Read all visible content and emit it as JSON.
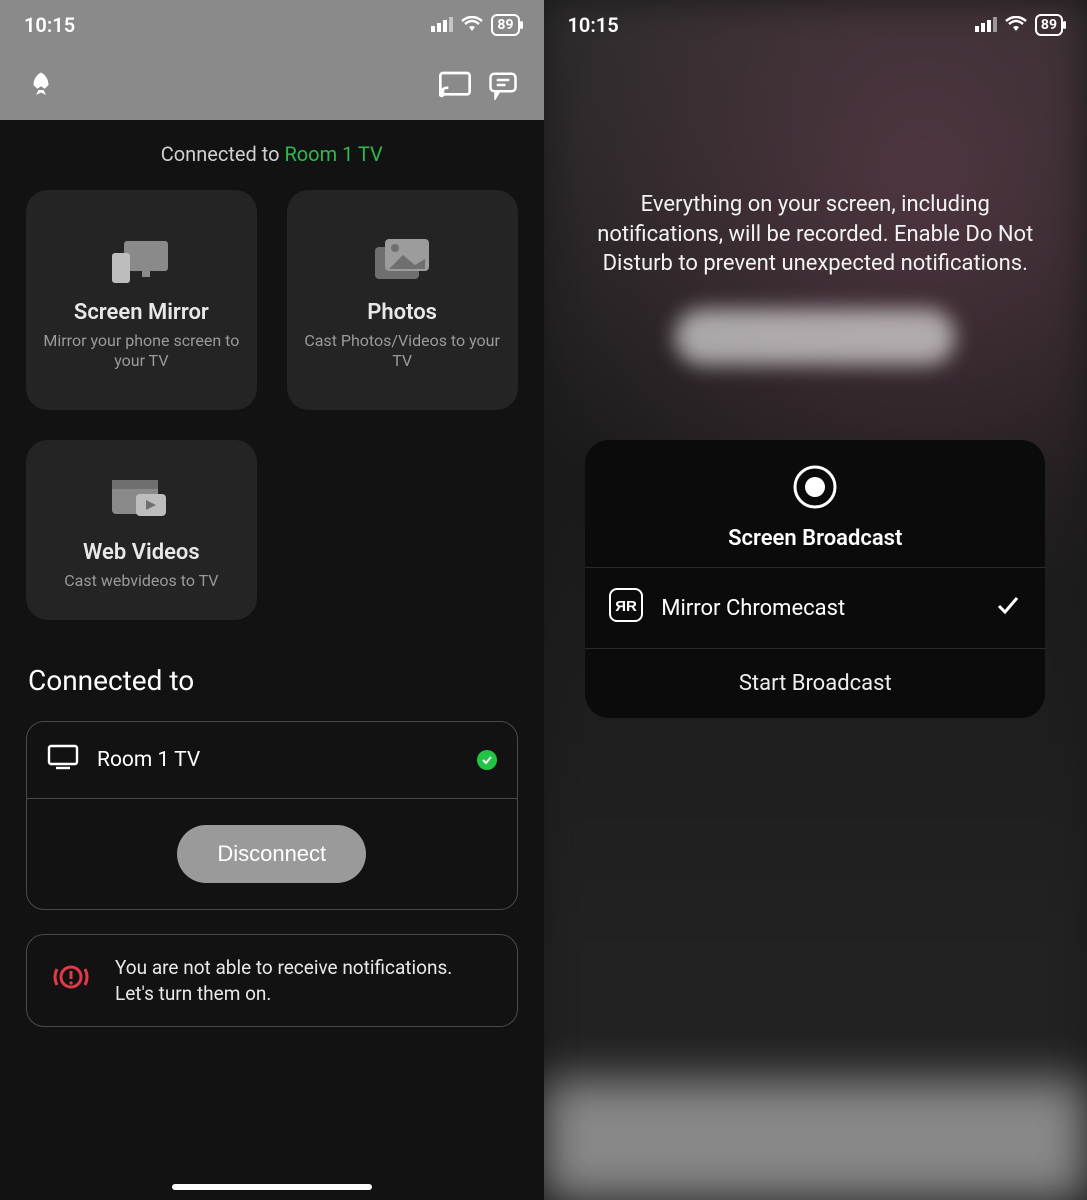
{
  "left": {
    "status": {
      "time": "10:15",
      "battery": "89"
    },
    "connected_prefix": "Connected to ",
    "connected_device": "Room 1 TV",
    "tiles": [
      {
        "title": "Screen Mirror",
        "desc": "Mirror your phone screen to your TV"
      },
      {
        "title": "Photos",
        "desc": "Cast Photos/Videos to your TV"
      },
      {
        "title": "Web Videos",
        "desc": "Cast webvideos to TV"
      }
    ],
    "section_heading": "Connected to",
    "device_row": {
      "name": "Room 1 TV"
    },
    "disconnect_label": "Disconnect",
    "notif_warning": "You are not able to receive notifications. Let's turn them on."
  },
  "right": {
    "status": {
      "time": "10:15",
      "battery": "89"
    },
    "overlay_text": "Everything on your screen, including notifications, will be recorded. Enable Do Not Disturb to prevent unexpected notifications.",
    "sheet": {
      "title": "Screen Broadcast",
      "option": "Mirror Chromecast",
      "start": "Start Broadcast"
    }
  }
}
